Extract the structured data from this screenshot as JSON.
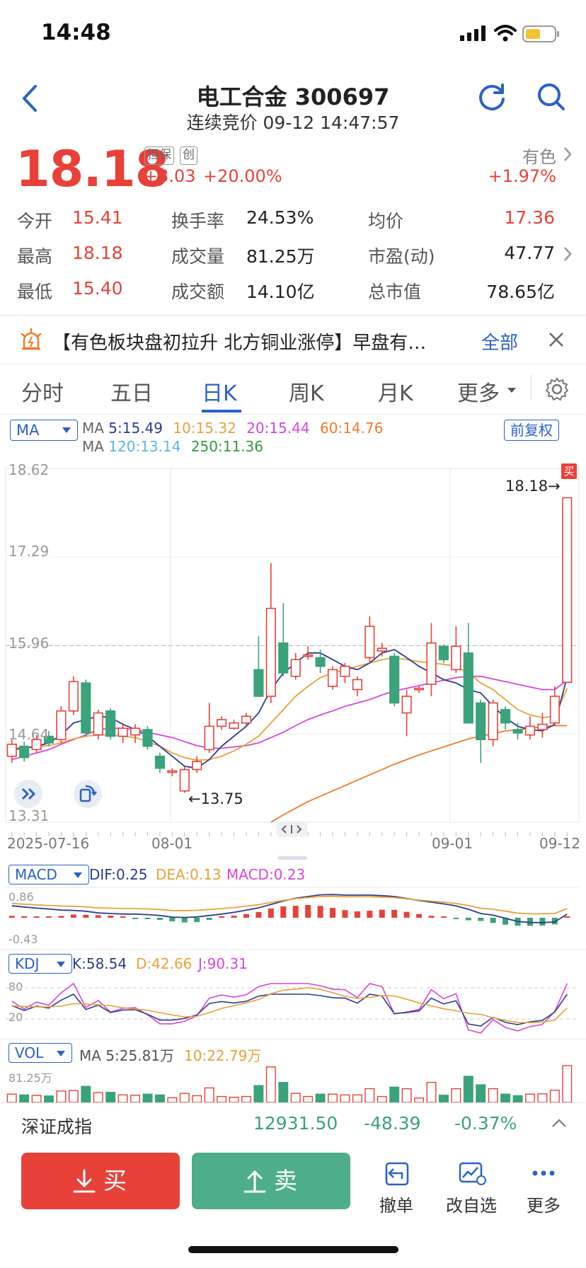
{
  "status": {
    "time": "14:48"
  },
  "header": {
    "title": "电工合金 300697",
    "subtitle": "连续竞价 09-12 14:47:57"
  },
  "quote": {
    "price": "18.18",
    "tag_margin": "担保",
    "tag_board": "创",
    "change": "+3.03",
    "change_pct": "+20.00%",
    "sector_name": "有色",
    "sector_pct": "+1.97%"
  },
  "stats": {
    "open_label": "今开",
    "open": "15.41",
    "high_label": "最高",
    "high": "18.18",
    "low_label": "最低",
    "low": "15.40",
    "turnover_label": "换手率",
    "turnover": "24.53%",
    "volume_label": "成交量",
    "volume": "81.25万",
    "amount_label": "成交额",
    "amount": "14.10亿",
    "avg_label": "均价",
    "avg": "17.36",
    "pe_label": "市盈(动)",
    "pe": "47.77",
    "mcap_label": "总市值",
    "mcap": "78.65亿"
  },
  "news": {
    "text": "【有色板块盘初拉升 北方铜业涨停】早盘有…",
    "all_label": "全部"
  },
  "tabs": [
    "分时",
    "五日",
    "日K",
    "周K",
    "月K",
    "更多"
  ],
  "ma_selector": "MA",
  "adjust_label": "前复权",
  "ma_legend": {
    "prefix": "MA",
    "ma5": "5:15.49",
    "ma10": "10:15.32",
    "ma20": "20:15.44",
    "ma60": "60:14.76",
    "ma120": "120:13.14",
    "ma250": "250:11.36"
  },
  "colors": {
    "ma5": "#2c3e8c",
    "ma10": "#e8a23a",
    "ma20": "#d845d8",
    "ma60": "#f07a2a",
    "ma120": "#5bb7e6",
    "ma250": "#2e9c3a",
    "up": "#e8413a",
    "down": "#3aa37b",
    "accent": "#2b61c9"
  },
  "chart_axis": {
    "y_ticks": [
      "18.62",
      "17.29",
      "15.96",
      "14.64",
      "13.31"
    ],
    "x_ticks": [
      "2025-07-16",
      "08-01",
      "09-01",
      "09-12"
    ],
    "high_marker": "18.18→",
    "low_marker": "←13.75",
    "buy_marker": "买"
  },
  "chart_data": {
    "type": "candlestick",
    "ylim": [
      13.31,
      18.62
    ],
    "candles": [
      {
        "o": 14.3,
        "c": 14.48,
        "h": 14.55,
        "l": 14.2
      },
      {
        "o": 14.45,
        "c": 14.28,
        "h": 14.52,
        "l": 14.22
      },
      {
        "o": 14.4,
        "c": 14.55,
        "h": 14.62,
        "l": 14.35
      },
      {
        "o": 14.6,
        "c": 14.5,
        "h": 14.68,
        "l": 14.45
      },
      {
        "o": 14.55,
        "c": 14.98,
        "h": 15.05,
        "l": 14.5
      },
      {
        "o": 14.98,
        "c": 15.42,
        "h": 15.5,
        "l": 14.92
      },
      {
        "o": 15.4,
        "c": 14.65,
        "h": 15.45,
        "l": 14.6
      },
      {
        "o": 14.62,
        "c": 14.95,
        "h": 15.0,
        "l": 14.55
      },
      {
        "o": 14.98,
        "c": 14.6,
        "h": 15.02,
        "l": 14.55
      },
      {
        "o": 14.6,
        "c": 14.72,
        "h": 14.8,
        "l": 14.5
      },
      {
        "o": 14.62,
        "c": 14.72,
        "h": 14.78,
        "l": 14.5
      },
      {
        "o": 14.7,
        "c": 14.45,
        "h": 14.75,
        "l": 14.4
      },
      {
        "o": 14.3,
        "c": 14.12,
        "h": 14.35,
        "l": 14.05
      },
      {
        "o": 14.08,
        "c": 14.08,
        "h": 14.12,
        "l": 14.0
      },
      {
        "o": 13.78,
        "c": 14.1,
        "h": 14.15,
        "l": 13.75
      },
      {
        "o": 14.1,
        "c": 14.22,
        "h": 14.3,
        "l": 14.05
      },
      {
        "o": 14.4,
        "c": 14.75,
        "h": 15.1,
        "l": 14.35
      },
      {
        "o": 14.75,
        "c": 14.85,
        "h": 14.9,
        "l": 14.7
      },
      {
        "o": 14.72,
        "c": 14.8,
        "h": 14.85,
        "l": 14.7
      },
      {
        "o": 14.8,
        "c": 14.9,
        "h": 14.95,
        "l": 14.75
      },
      {
        "o": 15.6,
        "c": 15.2,
        "h": 16.1,
        "l": 15.2
      },
      {
        "o": 15.2,
        "c": 16.52,
        "h": 17.2,
        "l": 15.1
      },
      {
        "o": 16.0,
        "c": 15.55,
        "h": 16.6,
        "l": 15.5
      },
      {
        "o": 15.5,
        "c": 15.75,
        "h": 15.85,
        "l": 15.45
      },
      {
        "o": 15.8,
        "c": 15.82,
        "h": 15.95,
        "l": 15.75
      },
      {
        "o": 15.78,
        "c": 15.65,
        "h": 15.9,
        "l": 15.55
      },
      {
        "o": 15.35,
        "c": 15.6,
        "h": 15.65,
        "l": 15.3
      },
      {
        "o": 15.5,
        "c": 15.65,
        "h": 15.7,
        "l": 15.4
      },
      {
        "o": 15.3,
        "c": 15.45,
        "h": 15.5,
        "l": 15.2
      },
      {
        "o": 15.78,
        "c": 16.25,
        "h": 16.4,
        "l": 15.7
      },
      {
        "o": 15.88,
        "c": 15.92,
        "h": 16.0,
        "l": 15.8
      },
      {
        "o": 15.8,
        "c": 15.1,
        "h": 15.85,
        "l": 15.05
      },
      {
        "o": 14.95,
        "c": 15.2,
        "h": 15.3,
        "l": 14.6
      },
      {
        "o": 15.3,
        "c": 15.32,
        "h": 15.35,
        "l": 15.25
      },
      {
        "o": 15.38,
        "c": 16.0,
        "h": 16.3,
        "l": 15.2
      },
      {
        "o": 15.95,
        "c": 15.75,
        "h": 15.98,
        "l": 15.7
      },
      {
        "o": 15.6,
        "c": 15.95,
        "h": 16.25,
        "l": 15.55
      },
      {
        "o": 15.85,
        "c": 14.8,
        "h": 16.3,
        "l": 14.8
      },
      {
        "o": 15.1,
        "c": 14.55,
        "h": 15.15,
        "l": 14.2
      },
      {
        "o": 14.55,
        "c": 15.1,
        "h": 15.15,
        "l": 14.45
      },
      {
        "o": 15.0,
        "c": 14.8,
        "h": 15.05,
        "l": 14.7
      },
      {
        "o": 14.7,
        "c": 14.65,
        "h": 14.8,
        "l": 14.55
      },
      {
        "o": 14.62,
        "c": 14.75,
        "h": 14.9,
        "l": 14.55
      },
      {
        "o": 14.7,
        "c": 14.78,
        "h": 14.95,
        "l": 14.58
      },
      {
        "o": 14.8,
        "c": 15.2,
        "h": 15.35,
        "l": 14.75
      },
      {
        "o": 15.41,
        "c": 18.18,
        "h": 18.18,
        "l": 15.4
      }
    ],
    "ma5_line": [
      14.4,
      14.42,
      14.45,
      14.5,
      14.62,
      14.8,
      14.85,
      14.9,
      14.88,
      14.78,
      14.7,
      14.6,
      14.45,
      14.3,
      14.15,
      14.12,
      14.25,
      14.45,
      14.6,
      14.75,
      14.95,
      15.3,
      15.55,
      15.7,
      15.85,
      15.85,
      15.75,
      15.65,
      15.6,
      15.7,
      15.85,
      15.9,
      15.78,
      15.65,
      15.55,
      15.45,
      15.4,
      15.3,
      15.25,
      15.05,
      14.88,
      14.75,
      14.7,
      14.68,
      14.78,
      15.49
    ],
    "ma10_line": [
      14.42,
      14.43,
      14.44,
      14.46,
      14.5,
      14.56,
      14.6,
      14.62,
      14.62,
      14.6,
      14.58,
      14.52,
      14.45,
      14.35,
      14.28,
      14.24,
      14.25,
      14.3,
      14.38,
      14.48,
      14.6,
      14.8,
      15.0,
      15.2,
      15.35,
      15.48,
      15.55,
      15.6,
      15.65,
      15.7,
      15.75,
      15.78,
      15.75,
      15.72,
      15.7,
      15.68,
      15.65,
      15.55,
      15.4,
      15.3,
      15.15,
      15.0,
      14.92,
      14.88,
      14.9,
      15.32
    ],
    "ma20_line": [
      14.25,
      14.3,
      14.35,
      14.4,
      14.48,
      14.55,
      14.62,
      14.7,
      14.72,
      14.72,
      14.7,
      14.66,
      14.62,
      14.58,
      14.52,
      14.46,
      14.42,
      14.42,
      14.44,
      14.46,
      14.5,
      14.58,
      14.66,
      14.76,
      14.85,
      14.92,
      14.98,
      15.05,
      15.1,
      15.15,
      15.22,
      15.28,
      15.32,
      15.36,
      15.4,
      15.44,
      15.48,
      15.5,
      15.5,
      15.46,
      15.42,
      15.38,
      15.34,
      15.3,
      15.3,
      15.44
    ],
    "ma60_line": [
      null,
      null,
      null,
      null,
      null,
      null,
      null,
      null,
      null,
      null,
      null,
      null,
      null,
      null,
      null,
      null,
      null,
      null,
      null,
      null,
      null,
      13.31,
      13.42,
      13.52,
      13.62,
      13.7,
      13.78,
      13.86,
      13.94,
      14.02,
      14.1,
      14.18,
      14.25,
      14.32,
      14.38,
      14.44,
      14.5,
      14.56,
      14.6,
      14.64,
      14.68,
      14.7,
      14.72,
      14.74,
      14.76,
      14.76
    ]
  },
  "macd": {
    "selector": "MACD",
    "dif": "DIF:0.25",
    "dea": "DEA:0.13",
    "macd": "MACD:0.23",
    "y_top": "0.86",
    "y_bottom": "-0.43"
  },
  "kdj": {
    "selector": "KDJ",
    "k": "K:58.54",
    "d": "D:42.66",
    "j": "J:90.31",
    "y_top": "80",
    "y_bottom": "20"
  },
  "vol": {
    "selector": "VOL",
    "ma5": "MA 5:25.81万",
    "ma10": "10:22.79万",
    "y_top": "81.25万"
  },
  "index_bar": {
    "name": "深证成指",
    "value": "12931.50",
    "change": "-48.39",
    "pct": "-0.37%"
  },
  "actions": {
    "buy": "买",
    "sell": "卖",
    "cancel": "撤单",
    "watchlist": "改自选",
    "more": "更多"
  }
}
